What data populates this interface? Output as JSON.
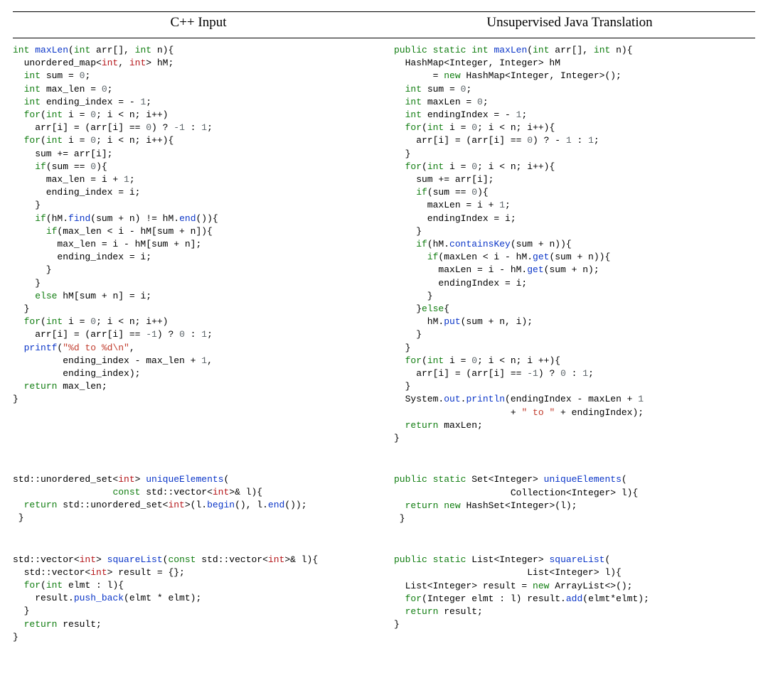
{
  "headers": {
    "left": "C++ Input",
    "right": "Unsupervised Java Translation"
  },
  "cpp1": {
    "l1_a": "int",
    "l1_b": "maxLen",
    "l1_c": "int",
    "l1_d": "int",
    "l2_a": "int",
    "l2_b": "int",
    "l3_a": "int",
    "l3_b": "0",
    "l4_a": "int",
    "l4_b": "0",
    "l5_a": "int",
    "l5_b": "1",
    "l6_a": "for",
    "l6_b": "int",
    "l6_c": "0",
    "l7_a": "0",
    "l7_b": "-1",
    "l7_c": "1",
    "l8_a": "for",
    "l8_b": "int",
    "l8_c": "0",
    "l10_a": "if",
    "l10_b": "0",
    "l11_a": "1",
    "l14_a": "if",
    "l14_b": "find",
    "l14_c": "end",
    "l15_a": "if",
    "l20_a": "else",
    "l22_a": "for",
    "l22_b": "int",
    "l22_c": "0",
    "l23_a": "-1",
    "l23_b": "0",
    "l23_c": "1",
    "l24_a": "printf",
    "l24_b": "\"%d to %d\\n\"",
    "l25_a": "1",
    "l27_a": "return"
  },
  "java1": {
    "l1_a": "public",
    "l1_b": "static",
    "l1_c": "int",
    "l1_d": "maxLen",
    "l1_e": "int",
    "l1_f": "int",
    "l3_a": "new",
    "l4_a": "int",
    "l4_b": "0",
    "l5_a": "int",
    "l5_b": "0",
    "l6_a": "int",
    "l6_b": "1",
    "l7_a": "for",
    "l7_b": "int",
    "l7_c": "0",
    "l8_a": "0",
    "l8_b": "1",
    "l8_c": "1",
    "l10_a": "for",
    "l10_b": "int",
    "l10_c": "0",
    "l12_a": "if",
    "l12_b": "0",
    "l13_a": "1",
    "l16_a": "if",
    "l16_b": "containsKey",
    "l17_a": "if",
    "l17_b": "get",
    "l18_a": "get",
    "l21_a": "else",
    "l22_a": "put",
    "l25_a": "for",
    "l25_b": "int",
    "l25_c": "0",
    "l26_a": "-1",
    "l26_b": "0",
    "l26_c": "1",
    "l28_a": "out",
    "l28_b": "println",
    "l28_c": "1",
    "l29_a": "\" to \"",
    "l30_a": "return"
  },
  "cpp2": {
    "l1_a": "int",
    "l1_b": "uniqueElements",
    "l2_a": "const",
    "l2_b": "int",
    "l3_a": "return",
    "l3_b": "int",
    "l3_c": "begin",
    "l3_d": "end"
  },
  "java2": {
    "l1_a": "public",
    "l1_b": "static",
    "l1_c": "uniqueElements",
    "l3_a": "return",
    "l3_b": "new"
  },
  "cpp3": {
    "l1_a": "int",
    "l1_b": "squareList",
    "l1_c": "const",
    "l1_d": "int",
    "l2_a": "int",
    "l3_a": "for",
    "l3_b": "int",
    "l4_a": "push_back",
    "l6_a": "return"
  },
  "java3": {
    "l1_a": "public",
    "l1_b": "static",
    "l1_c": "squareList",
    "l3_a": "new",
    "l4_a": "for",
    "l4_b": "add",
    "l5_a": "return"
  }
}
